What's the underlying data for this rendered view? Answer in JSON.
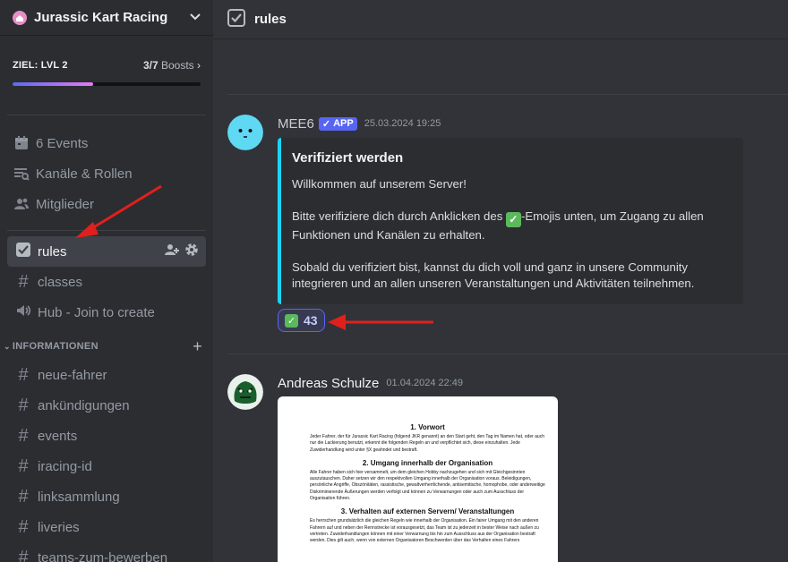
{
  "server": {
    "name": "Jurassic Kart Racing",
    "boost_goal": "ZIEL: LVL 2",
    "boost_count": "3/7",
    "boost_label": "Boosts",
    "boost_progress": 0.43
  },
  "nav": [
    {
      "label": "6 Events",
      "icon": "calendar-icon"
    },
    {
      "label": "Kanäle & Rollen",
      "icon": "channels-browse-icon"
    },
    {
      "label": "Mitglieder",
      "icon": "members-icon"
    }
  ],
  "channels_top": [
    {
      "label": "rules",
      "icon": "rules-icon",
      "active": true
    },
    {
      "label": "classes",
      "icon": "hash-icon"
    },
    {
      "label": "Hub - Join to create",
      "icon": "speaker-icon"
    }
  ],
  "category": {
    "label": "INFORMATIONEN"
  },
  "channels_info": [
    {
      "label": "neue-fahrer"
    },
    {
      "label": "ankündigungen"
    },
    {
      "label": "events"
    },
    {
      "label": "iracing-id"
    },
    {
      "label": "linksammlung"
    },
    {
      "label": "liveries"
    },
    {
      "label": "teams-zum-bewerben"
    }
  ],
  "channel": {
    "title": "rules"
  },
  "messages": [
    {
      "author": "MEE6",
      "tag": "APP",
      "time": "25.03.2024 19:25",
      "embed": {
        "title": "Verifiziert werden",
        "p1": "Willkommen auf unserem Server!",
        "p2_a": "Bitte verifiziere dich durch Anklicken des ",
        "p2_b": "-Emojis unten, um Zugang zu allen Funktionen und Kanälen zu erhalten.",
        "p3": "Sobald du verifiziert bist, kannst du dich voll und ganz in unsere Community integrieren und an allen unseren Veranstaltungen und Aktivitäten teilnehmen."
      },
      "reaction": {
        "count": "43"
      }
    },
    {
      "author": "Andreas Schulze",
      "time": "01.04.2024 22:49",
      "doc": {
        "h1": "1. Vorwort",
        "p1": "Jeder Fahrer, der für Jurassic Kart Racing (folgend JKR genannt) an den Start geht, den Tag im Namen hat, oder auch nur die Lackierung benutzt, erkennt die folgenden Regeln an und verpflichtet sich, diese einzuhalten. Jede Zuwiderhandlung wird unter §X geahndet und bestraft.",
        "h2": "2. Umgang innerhalb der Organisation",
        "p2": "Alle Fahrer haben sich hier versammelt, um dem gleichen Hobby nachzugehen und sich mit Gleichgesinnten auszutauschen. Daher setzen wir den respektvollen Umgang innerhalb der Organisation voraus. Beleidigungen, persönliche Angriffe, Obszönitäten, rassistische, gewaltverherrlichende, antisemitische, homophobe, oder anderweitige Diskriminierende Äußerungen werden verfolgt und können zu Verwarnungen oder auch zum Ausschluss der Organisation führen.",
        "h3": "3.  Verhalten auf externen Servern/ Veranstaltungen",
        "p3": "Es herrschen grundsätzlich die gleichen Regeln wie innerhalb der Organisation. Ein fairer Umgang mit den anderen Fahrern auf und neben der Rennstrecke ist vorausgesetzt, das Team ist zu jederzeit in bester Weise nach außen zu vertreten. Zuwiderhandlungen können mit einer Verwarnung bis hin zum Ausschluss aus der Organisation bestraft werden. Dies gilt auch, wenn von externen Organisatoren Beschwerden über das Verhalten eines Fahrers"
      }
    }
  ],
  "colors": {
    "accent": "#5865f2",
    "embed_border": "#1ad4f5",
    "arrow": "#e0201c"
  }
}
